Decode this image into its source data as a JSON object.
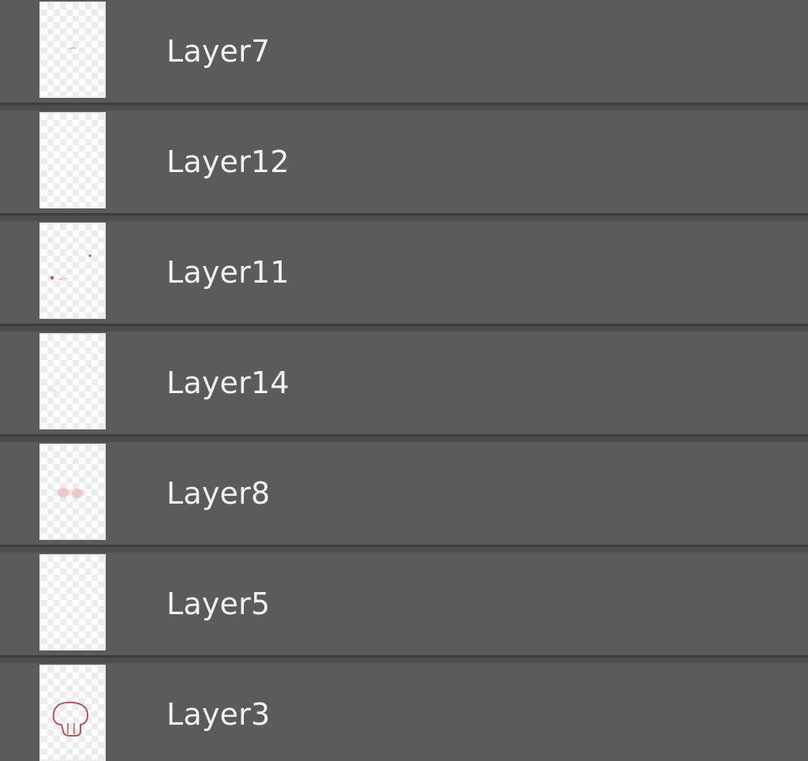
{
  "layers_panel": {
    "layers": [
      {
        "name": "Layer7",
        "thumbnail_icon": "layer7-thumbnail"
      },
      {
        "name": "Layer12",
        "thumbnail_icon": "layer12-thumbnail"
      },
      {
        "name": "Layer11",
        "thumbnail_icon": "layer11-thumbnail"
      },
      {
        "name": "Layer14",
        "thumbnail_icon": "layer14-thumbnail"
      },
      {
        "name": "Layer8",
        "thumbnail_icon": "layer8-thumbnail"
      },
      {
        "name": "Layer5",
        "thumbnail_icon": "layer5-thumbnail"
      },
      {
        "name": "Layer3",
        "thumbnail_icon": "layer3-thumbnail"
      }
    ],
    "colors": {
      "row_background": "#5b5b5b",
      "separator": "#3c3c3c",
      "text": "#f1f1f1",
      "thumbnail_mark": "#c2505e"
    }
  }
}
